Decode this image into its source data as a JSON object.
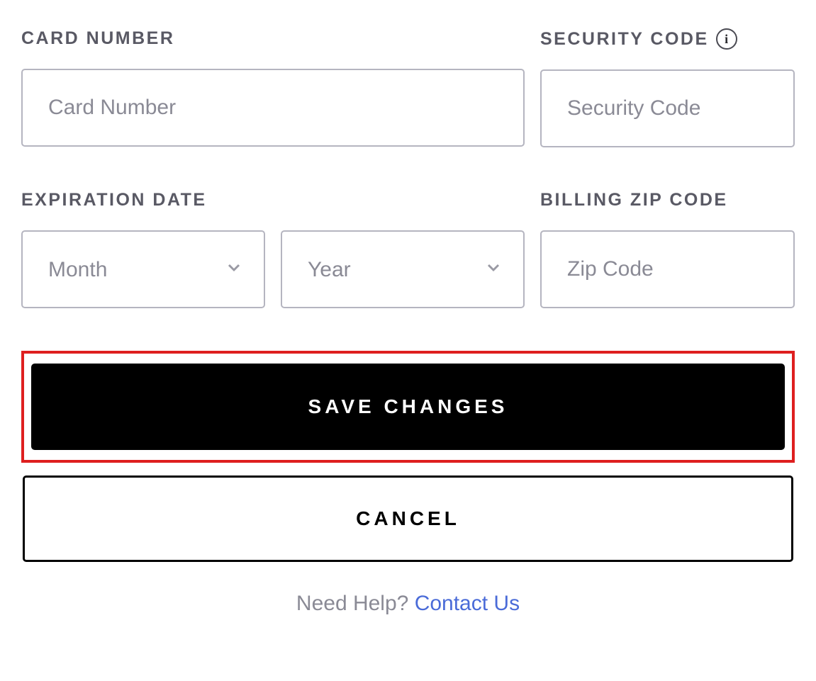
{
  "cardNumber": {
    "label": "CARD NUMBER",
    "placeholder": "Card Number",
    "value": ""
  },
  "securityCode": {
    "label": "SECURITY CODE",
    "placeholder": "Security Code",
    "value": ""
  },
  "expiration": {
    "label": "EXPIRATION DATE",
    "monthPlaceholder": "Month",
    "yearPlaceholder": "Year"
  },
  "zip": {
    "label": "BILLING ZIP CODE",
    "placeholder": "Zip Code",
    "value": ""
  },
  "buttons": {
    "save": "SAVE CHANGES",
    "cancel": "CANCEL"
  },
  "help": {
    "prompt": "Need Help? ",
    "link": "Contact Us"
  }
}
